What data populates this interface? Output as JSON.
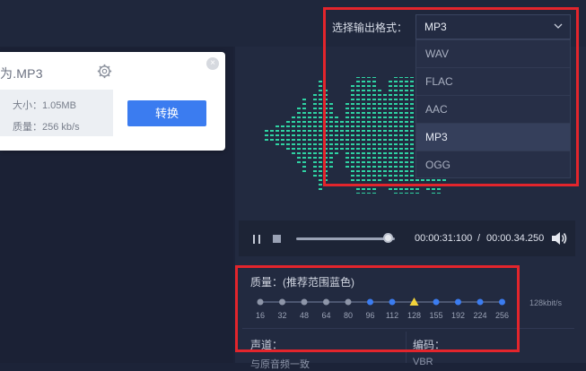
{
  "file": {
    "name": "为.MP3",
    "size": "大小：1.05MB",
    "bitrate": "质量：256 kb/s",
    "convert_label": "转换",
    "close_symbol": "×"
  },
  "format": {
    "label": "选择输出格式：",
    "selected": "MP3",
    "options": [
      "WAV",
      "FLAC",
      "AAC",
      "MP3",
      "OGG"
    ]
  },
  "player": {
    "current_time": "00:00:31:100",
    "separator": "/",
    "total_time": "00:00.34.250",
    "progress": 0.93
  },
  "quality": {
    "label": "质量：(推荐范围蓝色)",
    "ticks": [
      "16",
      "32",
      "48",
      "64",
      "80",
      "96",
      "112",
      "128",
      "155",
      "192",
      "224",
      "256"
    ],
    "selected": "128",
    "recommended_from": "96",
    "unit_label": "128kbit/s"
  },
  "channel": {
    "label": "声道：",
    "option": "与原音频一致"
  },
  "codec": {
    "label": "编码：",
    "option": "VBR"
  },
  "colors": {
    "accent": "#3b7cf0",
    "waveform": "#2fd3a3",
    "highlight": "#e3252c",
    "marker": "#f2d33b"
  },
  "icons": [
    "gear-icon",
    "close-icon",
    "chevron-down-icon",
    "pause-icon",
    "stop-icon",
    "volume-icon"
  ]
}
